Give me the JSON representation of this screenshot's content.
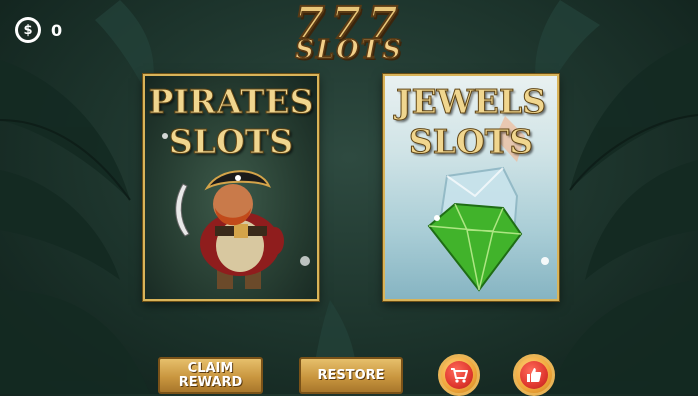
{
  "coins": {
    "icon": "dollar-coin-icon",
    "symbol": "$",
    "count": "0"
  },
  "logo": {
    "line1": "777",
    "line2": "SLOTS"
  },
  "games": [
    {
      "title": "PIRATES\nSLOTS",
      "art": "pirate-character"
    },
    {
      "title": "JEWELS\nSLOTS",
      "art": "green-diamond-and-crystal"
    }
  ],
  "buttons": {
    "claim_reward": "CLAIM\nREWARD",
    "restore": "RESTORE",
    "shop_icon": "shopping-cart-icon",
    "like_icon": "thumbs-up-icon"
  },
  "colors": {
    "gold": "#d9b45a",
    "button_gold": "#c9963f",
    "round_button": "#f0a63a",
    "round_inner": "#e0382f"
  }
}
